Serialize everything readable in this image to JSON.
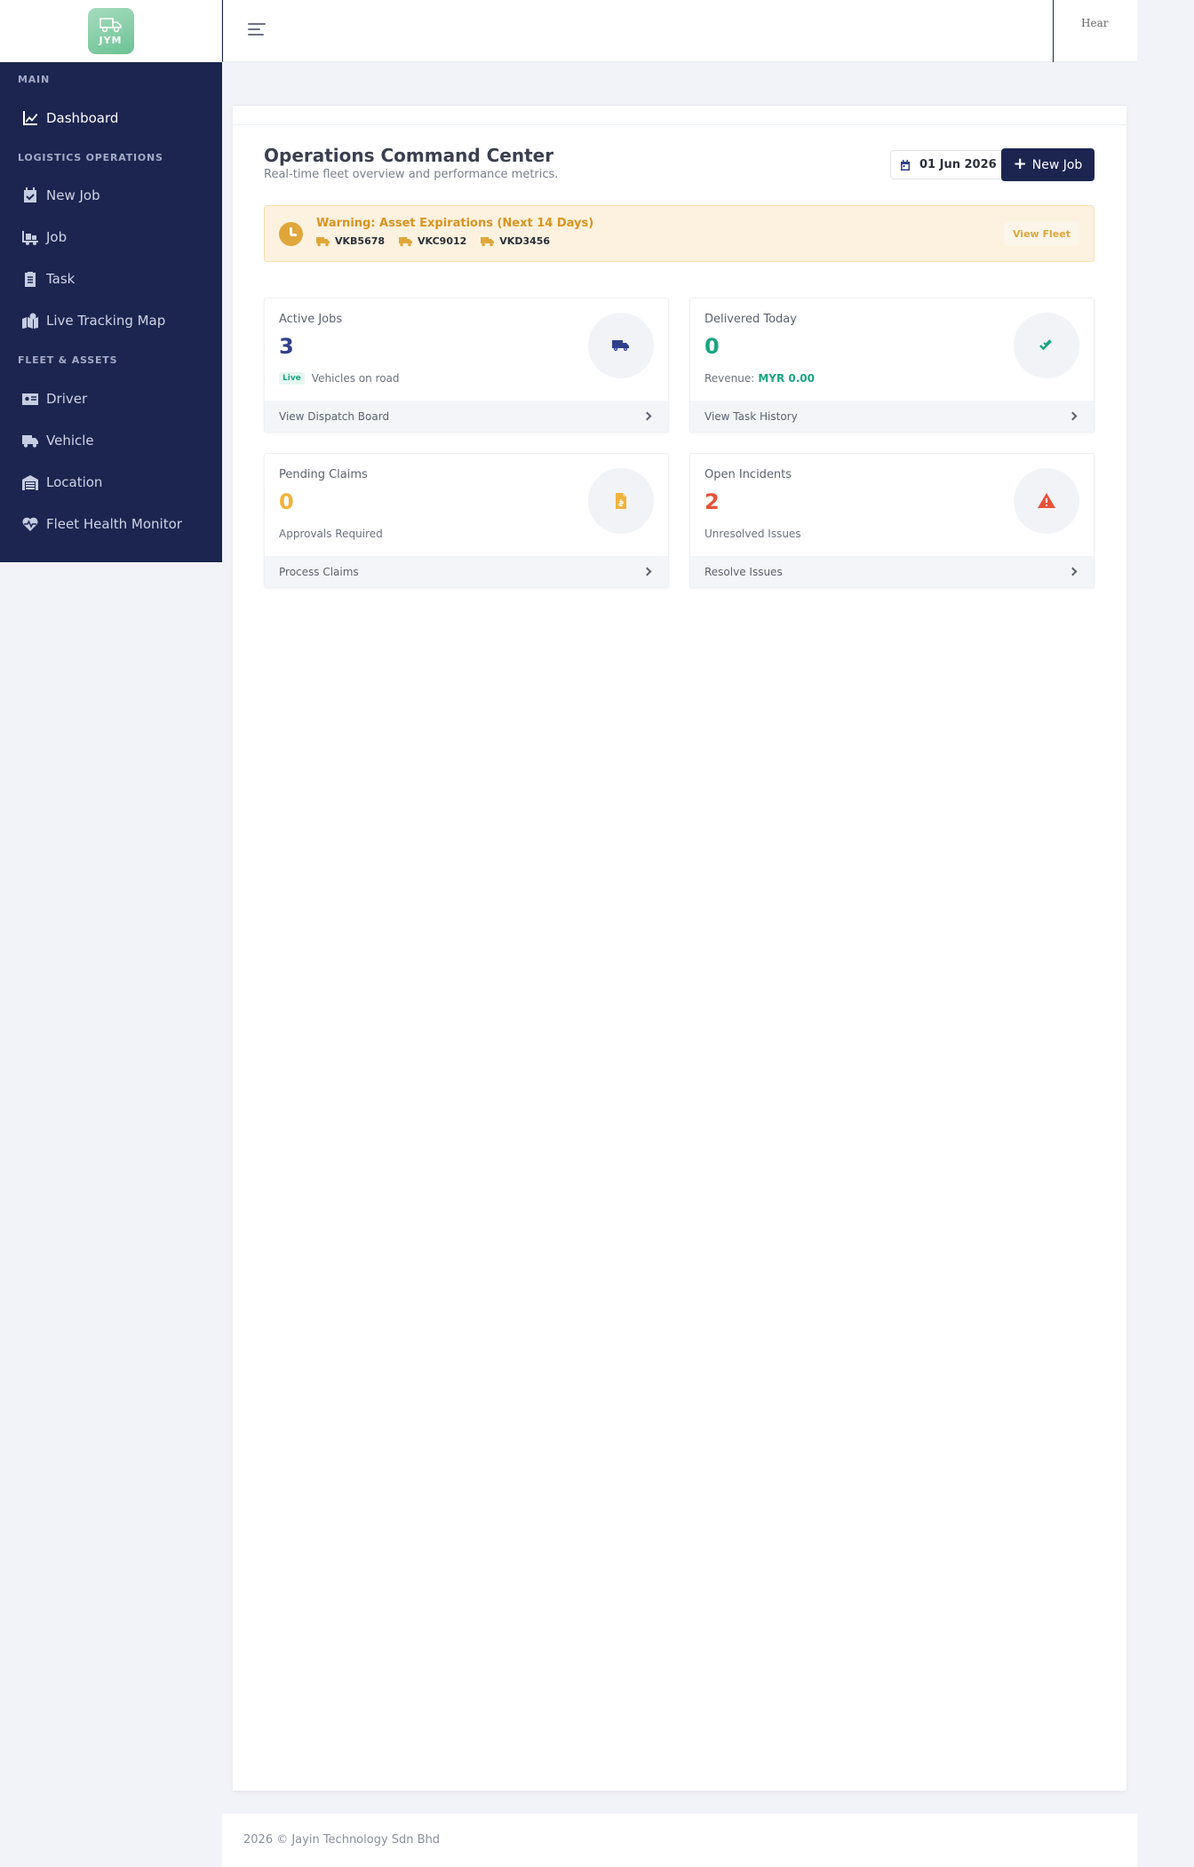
{
  "brand": {
    "logo_text": "JYM"
  },
  "sidebar": {
    "sections": {
      "main": "MAIN",
      "logistics": "LOGISTICS OPERATIONS",
      "fleet": "FLEET & ASSETS"
    },
    "items": {
      "dashboard": "Dashboard",
      "new_job": "New Job",
      "job": "Job",
      "task": "Task",
      "live_tracking": "Live Tracking Map",
      "driver": "Driver",
      "vehicle": "Vehicle",
      "location": "Location",
      "fleet_health": "Fleet Health Monitor"
    }
  },
  "topbar": {
    "avatar_alt": "Hear"
  },
  "header": {
    "title": "Operations Command Center",
    "subtitle": "Real-time fleet overview and performance metrics.",
    "date": "01 Jun 2026",
    "new_job_label": "New Job"
  },
  "alert": {
    "title": "Warning: Asset Expirations (Next 14 Days)",
    "plates": [
      "VKB5678",
      "VKC9012",
      "VKD3456"
    ],
    "action": "View Fleet"
  },
  "stats": {
    "active_jobs": {
      "label": "Active Jobs",
      "value": "3",
      "badge": "Live",
      "sub": "Vehicles on road",
      "footer": "View Dispatch Board"
    },
    "delivered_today": {
      "label": "Delivered Today",
      "value": "0",
      "sub": "Revenue:",
      "sub_value": "MYR 0.00",
      "footer": "View Task History"
    },
    "pending_claims": {
      "label": "Pending Claims",
      "value": "0",
      "sub": "Approvals Required",
      "footer": "Process Claims"
    },
    "open_incidents": {
      "label": "Open Incidents",
      "value": "2",
      "sub": "Unresolved Issues",
      "footer": "Resolve Issues"
    }
  },
  "colors": {
    "sidebar_bg": "#1c2550",
    "active_jobs_value": "#2f3f8a",
    "delivered_value": "#1aa581",
    "pending_value": "#f3b23a",
    "incident_value": "#e8523a"
  },
  "footer": {
    "text": "2026 © Jayin Technology Sdn Bhd"
  }
}
